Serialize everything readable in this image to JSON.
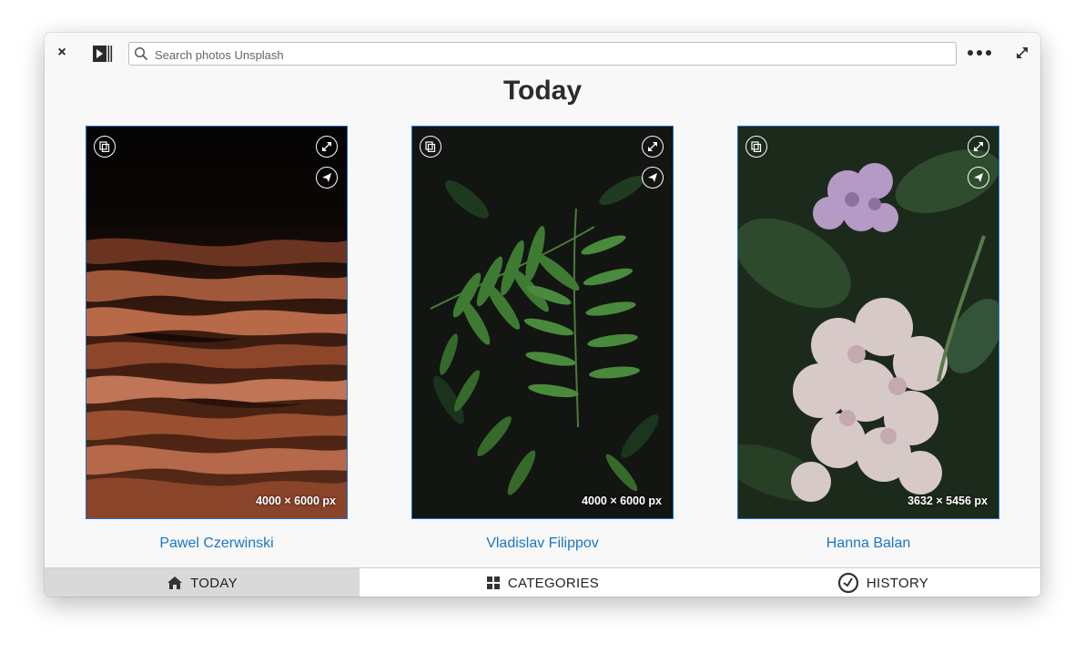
{
  "toolbar": {
    "close_label": "×",
    "search_placeholder": "Search photos Unsplash"
  },
  "page": {
    "title": "Today"
  },
  "photos": [
    {
      "author": "Pawel Czerwinski",
      "dimensions": "4000 × 6000  px"
    },
    {
      "author": "Vladislav Filippov",
      "dimensions": "4000 × 6000  px"
    },
    {
      "author": "Hanna Balan",
      "dimensions": "3632 × 5456  px"
    }
  ],
  "nav": {
    "tabs": [
      {
        "label": "TODAY",
        "icon": "home-icon",
        "active": true
      },
      {
        "label": "CATEGORIES",
        "icon": "grid-icon",
        "active": false
      },
      {
        "label": "HISTORY",
        "icon": "clock-icon",
        "active": false
      }
    ]
  },
  "colors": {
    "accent": "#1a76c6",
    "photo_border": "#1f6fd0"
  }
}
